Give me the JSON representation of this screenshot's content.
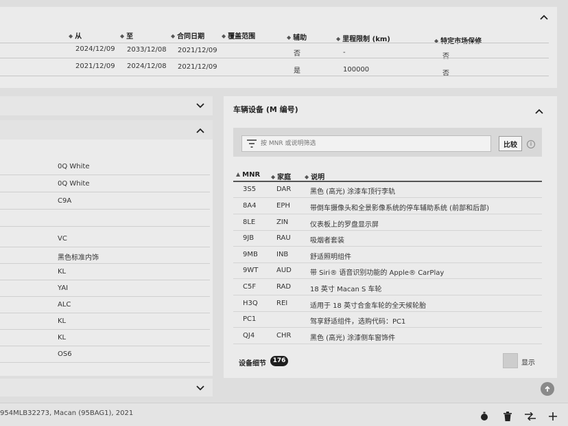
{
  "top_table": {
    "columns": [
      "从",
      "至",
      "合同日期",
      "覆盖范围",
      "辅助",
      "里程限制 (km)",
      "特定市场保修"
    ],
    "rows": [
      [
        "2024/12/09",
        "2033/12/08",
        "2021/12/09",
        "",
        "否",
        "-",
        "否"
      ],
      [
        "2021/12/09",
        "2024/12/08",
        "2021/12/09",
        "",
        "是",
        "100000",
        "否"
      ]
    ]
  },
  "left_list": {
    "values": [
      "0Q White",
      "0Q White",
      "C9A",
      "",
      "VC",
      "黑色标准内饰",
      "KL",
      "YAI",
      "ALC",
      "KL",
      "KL",
      "OS6"
    ]
  },
  "equipment": {
    "title": "车辆设备 (M 编号)",
    "filter_placeholder": "按 MNR 或说明筛选",
    "compare_label": "比较",
    "columns": [
      "MNR",
      "家庭",
      "说明"
    ],
    "rows": [
      [
        "3S5",
        "DAR",
        "黑色 (高光) 涂漆车顶行李轨"
      ],
      [
        "8A4",
        "EPH",
        "带倒车摄像头和全景影像系统的停车辅助系统 (前部和后部)"
      ],
      [
        "8LE",
        "ZIN",
        "仪表板上的罗盘显示屏"
      ],
      [
        "9JB",
        "RAU",
        "吸烟者套装"
      ],
      [
        "9MB",
        "INB",
        "舒适照明组件"
      ],
      [
        "9WT",
        "AUD",
        "带 Siri® 语音识别功能的 Apple® CarPlay"
      ],
      [
        "C5F",
        "RAD",
        "18 英寸 Macan S 车轮"
      ],
      [
        "H3Q",
        "REI",
        "适用于 18 英寸合金车轮的全天候轮胎"
      ],
      [
        "PC1",
        "",
        "驾享舒适组件，选购代码：PC1"
      ],
      [
        "QJ4",
        "CHR",
        "黑色 (高光) 涂漆侧车窗饰件"
      ]
    ],
    "details_label": "设备细节",
    "details_count": "176",
    "show_label": "显示"
  },
  "status_bar": {
    "vehicle_text": "954MLB32273, Macan (95BAG1), 2021"
  }
}
